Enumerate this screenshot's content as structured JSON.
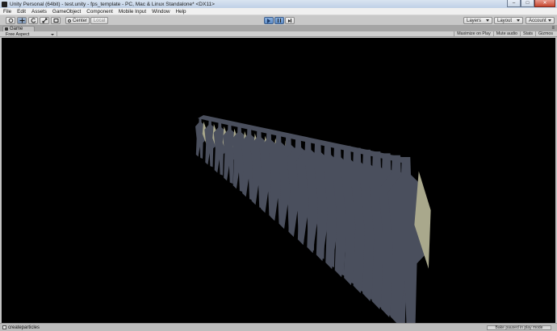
{
  "window": {
    "title": "Unity Personal (64bit) - test.unity - fps_template - PC, Mac & Linux Standalone* <DX11>",
    "minimize": "–",
    "maximize": "□",
    "close": "✕"
  },
  "menu": [
    "File",
    "Edit",
    "Assets",
    "GameObject",
    "Component",
    "Mobile Input",
    "Window",
    "Help"
  ],
  "toolbar": {
    "pivot_label": "Center",
    "space_label": "Local",
    "layers_label": "Layers",
    "layout_label": "Layout",
    "account_label": "Account",
    "transform_tools": [
      "hand-tool",
      "move-tool",
      "rotate-tool",
      "scale-tool",
      "rect-tool"
    ]
  },
  "game_panel": {
    "tab_label": "Game",
    "aspect": "Free Aspect",
    "buttons": [
      "Maximize on Play",
      "Mute audio",
      "Stats",
      "Gizmos"
    ]
  },
  "status": {
    "message": "createparticles",
    "bake_status": "Bake paused in play mode"
  },
  "colors": {
    "figure_dark": "#4a4f5d",
    "figure_light": "#a9a88c",
    "viewport_bg": "#000000",
    "play_accent": "#5f8dc6"
  }
}
